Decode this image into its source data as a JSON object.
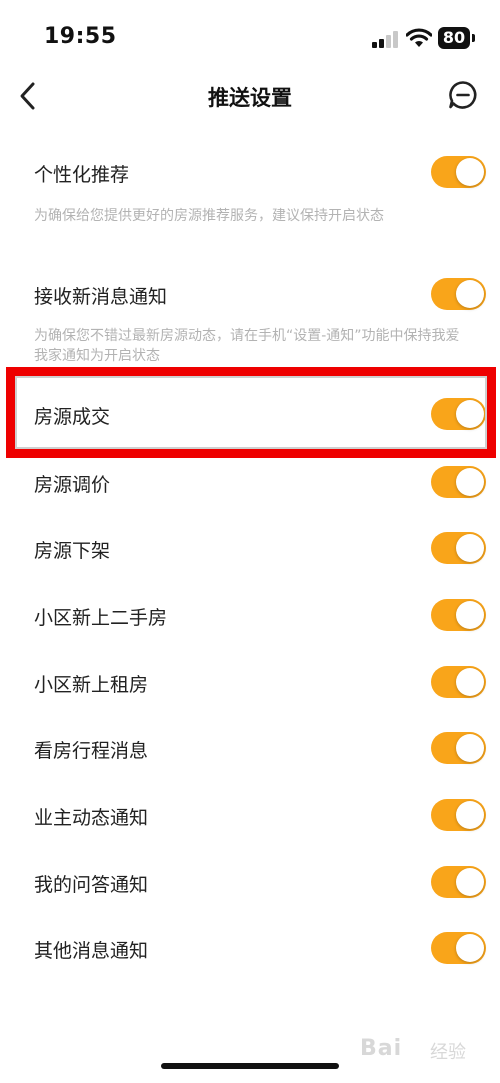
{
  "status_bar": {
    "time": "19:55",
    "battery": "80"
  },
  "nav": {
    "title": "推送设置"
  },
  "sections": [
    {
      "label": "个性化推荐",
      "hint": "为确保给您提供更好的房源推荐服务，建议保持开启状态",
      "on": true
    },
    {
      "label": "接收新消息通知",
      "hint": "为确保您不错过最新房源动态，请在手机“设置-通知”功能中保持我爱我家通知为开启状态",
      "on": true
    }
  ],
  "items": [
    {
      "label": "房源成交",
      "on": true,
      "highlighted": true
    },
    {
      "label": "房源调价",
      "on": true
    },
    {
      "label": "房源下架",
      "on": true
    },
    {
      "label": "小区新上二手房",
      "on": true
    },
    {
      "label": "小区新上租房",
      "on": true
    },
    {
      "label": "看房行程消息",
      "on": true
    },
    {
      "label": "业主动态通知",
      "on": true
    },
    {
      "label": "我的问答通知",
      "on": true
    },
    {
      "label": "其他消息通知",
      "on": true
    }
  ],
  "colors": {
    "toggle_on": "#f9a51a",
    "highlight": "#ee0000"
  },
  "watermark": {
    "brand": "Bai",
    "suffix": "经验"
  }
}
